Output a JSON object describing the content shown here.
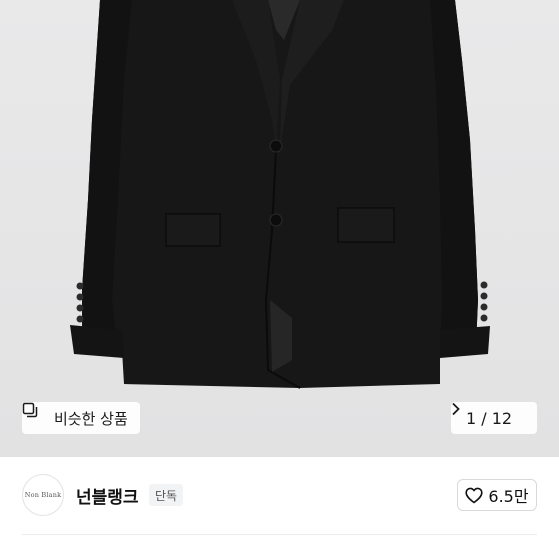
{
  "product_image": {
    "similar_button_label": "비슷한 상품",
    "counter_current": "1",
    "counter_separator": "/",
    "counter_total": "12",
    "icons": {
      "similar": "square-stack-icon",
      "next": "chevron-right-icon"
    }
  },
  "shop": {
    "logo_text": "Non Blank",
    "name": "넌블랭크",
    "badge": "단독",
    "like_count": "6.5만",
    "icons": {
      "like": "heart-outline-icon"
    }
  },
  "colors": {
    "hero_background": "#e6e6e7",
    "jacket": "#161616",
    "badge_background": "#f2f3f5"
  }
}
